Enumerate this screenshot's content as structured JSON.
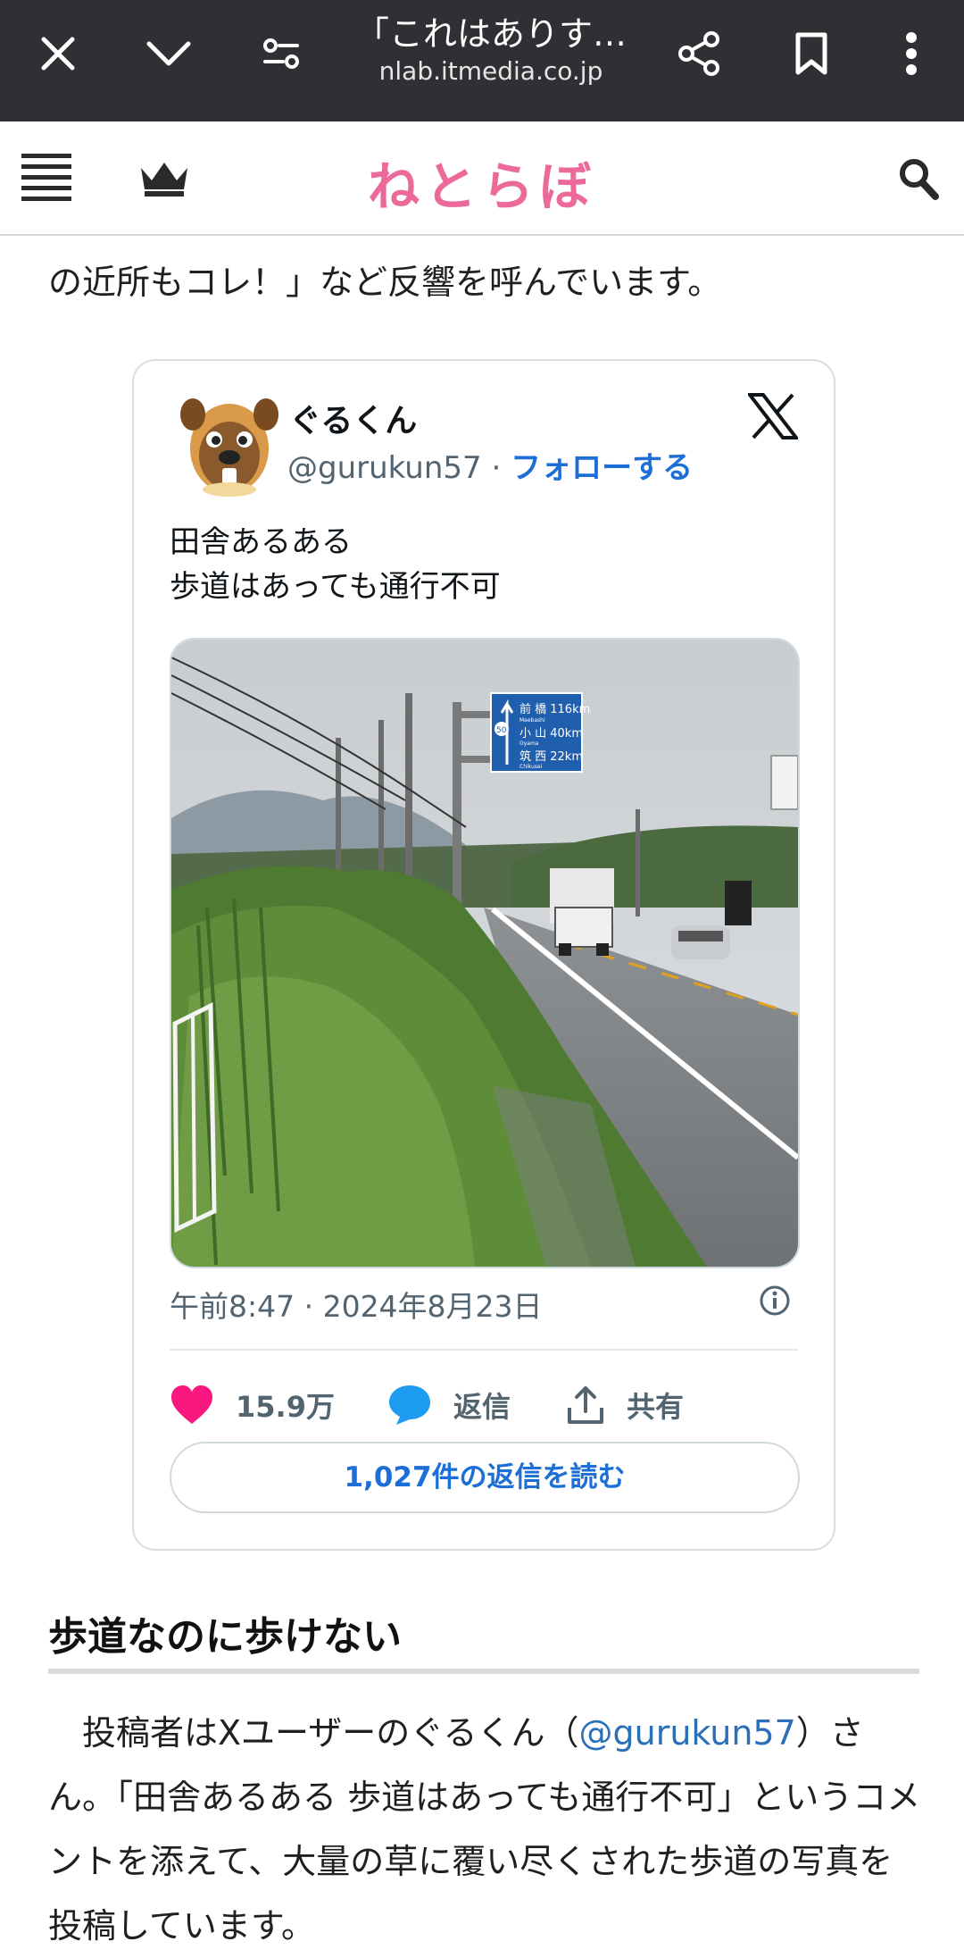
{
  "browser": {
    "title": "「これはありす…",
    "url": "nlab.itmedia.co.jp",
    "icons": [
      "close-icon",
      "chevron-down-icon",
      "page-settings-icon",
      "share-icon",
      "bookmark-icon",
      "more-vert-icon"
    ]
  },
  "site": {
    "logo": "ねとらぼ",
    "icons": [
      "menu-icon",
      "crown-icon",
      "search-icon"
    ]
  },
  "article": {
    "intro_line": "の近所もコレ！」など反響を呼んでいます。",
    "section_heading": "歩道なのに歩けない",
    "body_prefix": "　投稿者はXユーザーのぐるくん（",
    "body_link": "@gurukun57",
    "body_suffix": "）さん。「田舎あるある 歩道はあっても通行不可」というコメントを添えて、大量の草に覆い尽くされた歩道の写真を投稿しています。"
  },
  "tweet": {
    "display_name": "ぐるくん",
    "handle": "@gurukun57",
    "separator": "·",
    "follow_label": "フォローする",
    "text_line1": "田舎あるある",
    "text_line2": "歩道はあっても通行不可",
    "sign": {
      "line1": "前 橋 116km",
      "line1_sub": "Maebashi",
      "line2": "小 山 40km",
      "line2_sub": "Oyama",
      "line3": "筑 西 22km",
      "line3_sub": "Chikusei",
      "route": "50"
    },
    "time": "午前8:47 · 2024年8月23日",
    "likes": "15.9万",
    "reply_label": "返信",
    "share_label": "共有",
    "read_replies": "1,027件の返信を読む"
  },
  "colors": {
    "topbar": "#2f3033",
    "logo_pink": "#ec6a9a",
    "link_blue": "#1d6fd8",
    "heart": "#f91880",
    "reply_blue": "#1d9bf0"
  }
}
